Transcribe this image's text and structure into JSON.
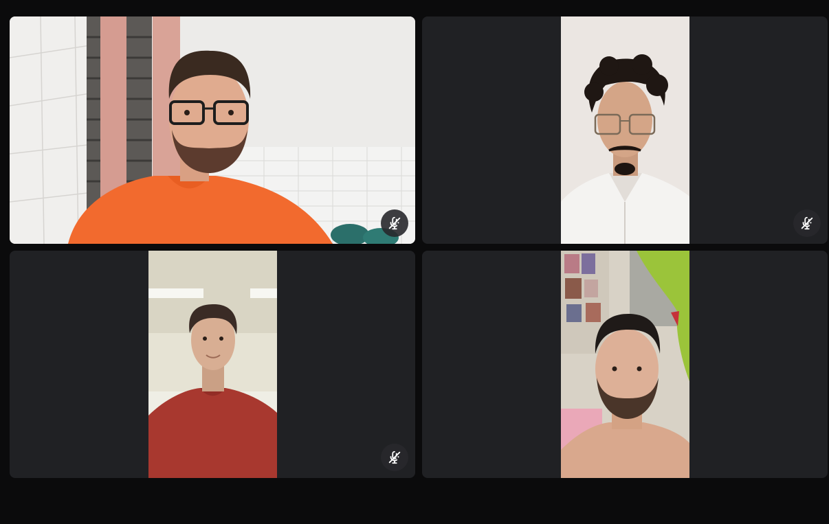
{
  "colors": {
    "background": "#0b0b0c",
    "tile": "#202124",
    "mute_badge": "#2b2b2f"
  },
  "participants": [
    {
      "muted": true,
      "icon": "mic-off-icon"
    },
    {
      "muted": true,
      "icon": "mic-off-icon"
    },
    {
      "muted": true,
      "icon": "mic-off-icon"
    },
    {
      "muted": false
    }
  ]
}
